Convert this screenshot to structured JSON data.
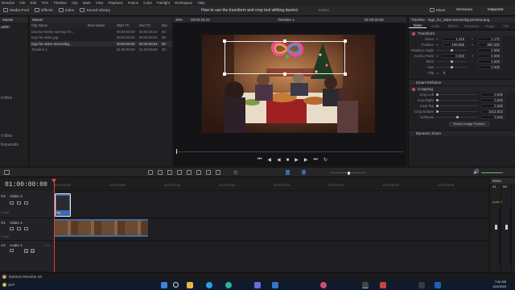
{
  "menubar": {
    "items": [
      "Resolve",
      "File",
      "Edit",
      "Trim",
      "Timeline",
      "Clip",
      "Mark",
      "View",
      "Playback",
      "Fusion",
      "Color",
      "Fairlight",
      "Workspace",
      "Help"
    ]
  },
  "toolbar": {
    "left": [
      "Media Pool",
      "Effects",
      "Index",
      "Sound Library"
    ],
    "project_title": "How to use the transform and crop tool withing davinci",
    "edited": "Edited",
    "right": [
      "Mixer",
      "Metadata",
      "Inspector"
    ]
  },
  "mediapool": {
    "side_label": "Master",
    "side_items": [
      "aster",
      "rt Bins",
      "rt Bins",
      "Keywords"
    ],
    "bin_name": "Master",
    "columns": [
      "Clip Name",
      "Reel Name",
      "Start TC",
      "End TC",
      "Dur"
    ],
    "rows": [
      {
        "name": "Diverse-family-serving-chr...",
        "reel": "",
        "start": "00:00:00:00",
        "end": "00:00:26:24",
        "dur": "00:"
      },
      {
        "name": "logo-for-video.jpg",
        "reel": "",
        "start": "00:00:00:00",
        "end": "00:00:00:04",
        "dur": "00:"
      },
      {
        "name": "logo-for-video-removebg...",
        "reel": "",
        "start": "00:00:00:00",
        "end": "00:00:00:04",
        "dur": "00:"
      },
      {
        "name": "Timeline 1",
        "reel": "",
        "start": "01:00:00:00",
        "end": "01:00:05:00",
        "dur": "00:"
      }
    ]
  },
  "viewer": {
    "zoom": "39%",
    "source_tc": "00:00:26:24",
    "timeline_name": "Timeline 1",
    "record_tc": "01:00:00:00"
  },
  "inspector": {
    "title": "Timeline - logo_for_video-removebg-preview.png",
    "tabs": [
      "Video",
      "Audio",
      "Effects",
      "Transition",
      "Image",
      "File"
    ],
    "transform_label": "Transform",
    "zoom": {
      "label": "Zoom",
      "x": "1.218",
      "y": "1.171"
    },
    "position": {
      "label": "Position",
      "x": "-109.886",
      "y": "692.282"
    },
    "rotation": {
      "label": "Rotation Angle",
      "value": "0.000"
    },
    "anchor": {
      "label": "Anchor Point",
      "x": "0.000",
      "y": "0.000"
    },
    "pitch": {
      "label": "Pitch",
      "value": "0.000"
    },
    "yaw": {
      "label": "Yaw",
      "value": "0.000"
    },
    "flip": {
      "label": "Flip"
    },
    "smart_reframe": "Smart Reframe",
    "cropping_label": "Cropping",
    "crop_left": {
      "label": "Crop Left",
      "value": "0.000"
    },
    "crop_right": {
      "label": "Crop Right",
      "value": "0.000"
    },
    "crop_top": {
      "label": "Crop Top",
      "value": "0.000"
    },
    "crop_bottom": {
      "label": "Crop Bottom",
      "value": "1012.833"
    },
    "softness": {
      "label": "Softness",
      "value": "0.000"
    },
    "retain_btn": "Retain Image Position",
    "dynamic_zoom": "Dynamic Zoom"
  },
  "timeline": {
    "timecode": "01:00:00:00",
    "ruler": [
      "01:00:00:00",
      "01:00:08:00",
      "01:00:16:00",
      "01:00:24:00",
      "01:00:32:00",
      "01:00:40:00",
      "01:00:48:00",
      "01:00:56:00"
    ],
    "tracks": [
      {
        "id": "V2",
        "name": "Video 2",
        "clips": "0 Clip"
      },
      {
        "id": "V1",
        "name": "Video 1",
        "clips": "1 Clip"
      },
      {
        "id": "A1",
        "name": "Audio 1",
        "clips": "2.0"
      }
    ],
    "clip_label": "log..."
  },
  "mixer": {
    "title": "Mixer",
    "channels": [
      "A1",
      "M1"
    ],
    "lang": "Audio 1"
  },
  "statusbar": {
    "app_name": "DaVinci Resolve 18"
  },
  "taskbar": {
    "weather": "28°F",
    "time": "7:44 AM",
    "date": "1/24/2023"
  },
  "colors": {
    "accent_red": "#d24a4a",
    "accent_orange": "#e0a030",
    "clip_blue": "#3f6aa8"
  }
}
